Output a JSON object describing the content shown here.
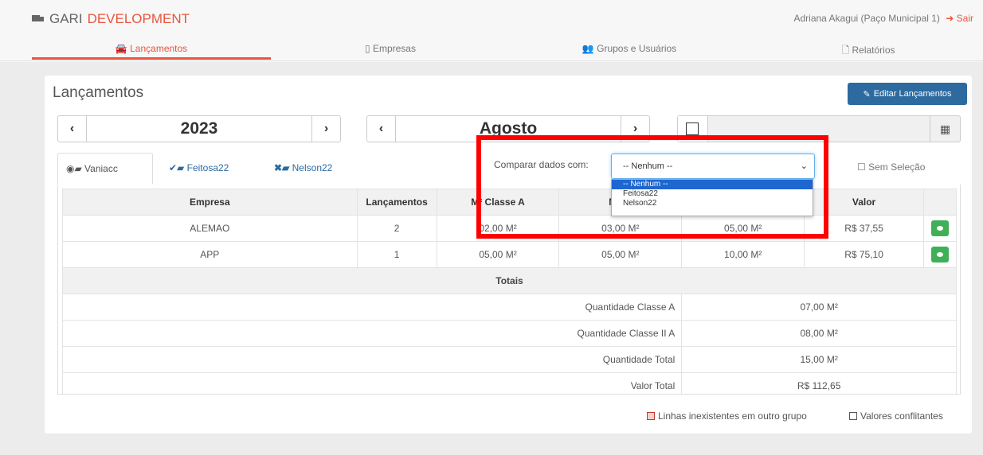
{
  "header": {
    "brand_prefix": "GARI",
    "brand_suffix": "DEVELOPMENT",
    "user": "Adriana Akagui (Paço Municipal 1)",
    "logout": "Sair"
  },
  "nav": {
    "items": [
      {
        "label": "Lançamentos",
        "icon": "car-icon",
        "active": true
      },
      {
        "label": "Empresas",
        "icon": "building-icon",
        "active": false
      },
      {
        "label": "Grupos e Usuários",
        "icon": "users-icon",
        "active": false
      },
      {
        "label": "Relatórios",
        "icon": "file-icon",
        "active": false
      }
    ]
  },
  "page": {
    "title": "Lançamentos",
    "edit_button": "Editar Lançamentos"
  },
  "filters": {
    "year": "2023",
    "month": "Agosto"
  },
  "tabs": [
    {
      "label": "Vaniacc",
      "icon": "user-folder-icon",
      "active": true
    },
    {
      "label": "Feitosa22",
      "icon": "check-folder-icon",
      "active": false
    },
    {
      "label": "Nelson22",
      "icon": "x-folder-icon",
      "active": false
    }
  ],
  "compare": {
    "label": "Comparar dados com:",
    "selected": "-- Nenhum --",
    "options": [
      "-- Nenhum --",
      "Feitosa22",
      "Nelson22"
    ],
    "no_selection": "Sem Seleção"
  },
  "table": {
    "headers": [
      "Empresa",
      "Lançamentos",
      "M² Classe A",
      "M² Cl",
      "",
      "Valor",
      ""
    ],
    "rows": [
      {
        "empresa": "ALEMAO",
        "lancamentos": "2",
        "classe_a": "02,00 M²",
        "classe_ii_a": "03,00 M²",
        "total": "05,00 M²",
        "valor": "R$ 37,55"
      },
      {
        "empresa": "APP",
        "lancamentos": "1",
        "classe_a": "05,00 M²",
        "classe_ii_a": "05,00 M²",
        "total": "10,00 M²",
        "valor": "R$ 75,10"
      }
    ],
    "totals_label": "Totais",
    "summary": [
      {
        "label": "Quantidade Classe A",
        "value": "07,00 M²"
      },
      {
        "label": "Quantidade Classe II A",
        "value": "08,00 M²"
      },
      {
        "label": "Quantidade Total",
        "value": "15,00 M²"
      },
      {
        "label": "Valor Total",
        "value": "R$ 112,65"
      }
    ]
  },
  "legend": {
    "missing_lines": "Linhas inexistentes em outro grupo",
    "conflicting": "Valores conflitantes"
  },
  "colors": {
    "brand": "#e8553e",
    "primary": "#2d6a9f",
    "success": "#3fb058",
    "highlight": "#ff0000"
  }
}
